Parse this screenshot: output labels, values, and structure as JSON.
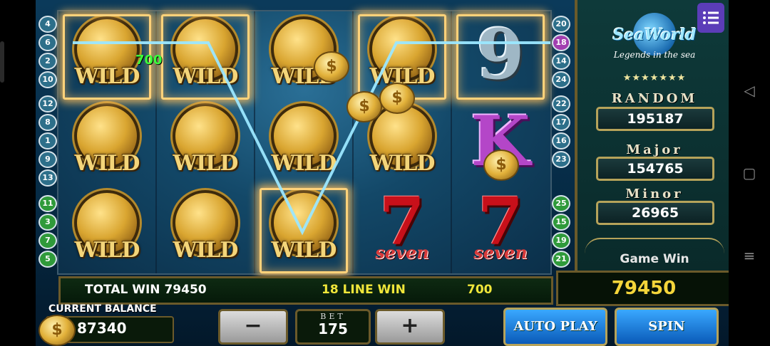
{
  "game": {
    "logo_name": "SeaWorld",
    "logo_subtitle": "Legends in the sea",
    "stars": "★★★★★★★",
    "win_popup": "700",
    "symbols": {
      "wild": "WILD",
      "k": "K",
      "nine": "9",
      "seven": "7",
      "seven_word": "seven",
      "coin": "$"
    },
    "line_markers_left": [
      "4",
      "6",
      "2",
      "10",
      "12",
      "8",
      "1",
      "9",
      "13",
      "11",
      "3",
      "7",
      "5"
    ],
    "line_markers_right": [
      "20",
      "18",
      "14",
      "24",
      "22",
      "17",
      "16",
      "23",
      "25",
      "15",
      "19",
      "21"
    ]
  },
  "jackpots": [
    {
      "label": "RANDOM",
      "value": "195187"
    },
    {
      "label": "Major",
      "value": "154765"
    },
    {
      "label": "Minor",
      "value": "26965"
    }
  ],
  "win_bar": {
    "total_win_label": "TOTAL WIN 79450",
    "line_win_label": "18 LINE WIN",
    "line_win_value": "700"
  },
  "game_win": {
    "label": "Game Win",
    "value": "79450"
  },
  "balance": {
    "label": "CURRENT BALANCE",
    "value": "87340"
  },
  "bet": {
    "label": "BET",
    "value": "175",
    "minus": "−",
    "plus": "+"
  },
  "buttons": {
    "auto_play": "AUTO PLAY",
    "spin": "SPIN"
  },
  "colors": {
    "accent_gold": "#b6a35a",
    "win_text": "#f4d53a",
    "line_win_text": "#f0e63a",
    "menu_button": "#5b3db8"
  },
  "icons": {
    "menu": "menu-list-icon",
    "back": "back-icon",
    "home": "home-icon",
    "recents": "recents-icon"
  }
}
